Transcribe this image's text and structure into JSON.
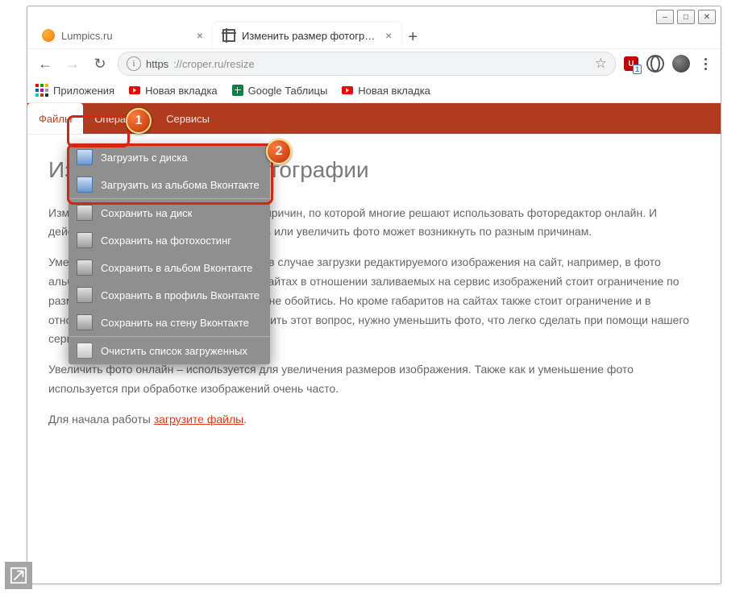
{
  "window": {
    "min": "–",
    "max": "□",
    "close": "✕"
  },
  "tabs": [
    {
      "title": "Lumpics.ru",
      "favcolor": "#f17900",
      "active": false
    },
    {
      "title": "Изменить размер фотографии",
      "fav": "crop",
      "active": true
    }
  ],
  "newtab": "+",
  "nav": {
    "back": "←",
    "fwd": "→",
    "reload": "↻"
  },
  "address": {
    "scheme": "https",
    "rest": "://croper.ru/resize"
  },
  "star": "☆",
  "bookmarks": [
    {
      "icon": "apps",
      "label": "Приложения"
    },
    {
      "icon": "yt",
      "label": "Новая вкладка"
    },
    {
      "icon": "gs",
      "label": "Google Таблицы"
    },
    {
      "icon": "yt",
      "label": "Новая вкладка"
    }
  ],
  "menu": [
    {
      "label": "Файлы",
      "active": true
    },
    {
      "label": "Операции",
      "active": false
    },
    {
      "label": "Сервисы",
      "active": false
    }
  ],
  "dropdown": {
    "group1": [
      {
        "ico": "up",
        "label": "Загрузить с диска"
      },
      {
        "ico": "up",
        "label": "Загрузить из альбома Вконтакте"
      }
    ],
    "group2": [
      {
        "ico": "disk",
        "label": "Сохранить на диск"
      },
      {
        "ico": "disk",
        "label": "Сохранить на фотохостинг"
      },
      {
        "ico": "disk",
        "label": "Сохранить в альбом Вконтакте"
      },
      {
        "ico": "disk",
        "label": "Сохранить в профиль Вконтакте"
      },
      {
        "ico": "disk",
        "label": "Сохранить на стену Вконтакте"
      }
    ],
    "group3": [
      {
        "ico": "clear",
        "label": "Очистить список загруженных"
      }
    ]
  },
  "page": {
    "h1": "Изменить размер фотографии",
    "p1": "Изменить размер фото – одна из частых причин, по которой многие решают использовать фоторедактор онлайн. И действительно необходимость уменьшить или увеличить фото может возникнуть по разным причинам.",
    "p2": "Уменьшить фото требуется, как правило, в случае загрузки редактируемого изображения на сайт, например, в фото альбом Вконтакте. Поскольку на многих сайтах в отношении заливаемых на сервис изображений стоит ограничение по размеру, то без изменения размера фото не обойтись. Но кроме габаритов на сайтах также стоит ограничение и в отношении веса изображения. Чтобы решить этот вопрос, нужно уменьшить фото, что легко сделать при помощи нашего сервиса.",
    "p3": "Увеличить фото онлайн – используется для увеличения размеров изображения. Также как и уменьшение фото используется при обработке изображений очень часто.",
    "cta_pre": "Для начала работы ",
    "cta_link": "загрузите файлы",
    "cta_post": "."
  },
  "annot": {
    "b1": "1",
    "b2": "2"
  },
  "ublock_count": "1"
}
